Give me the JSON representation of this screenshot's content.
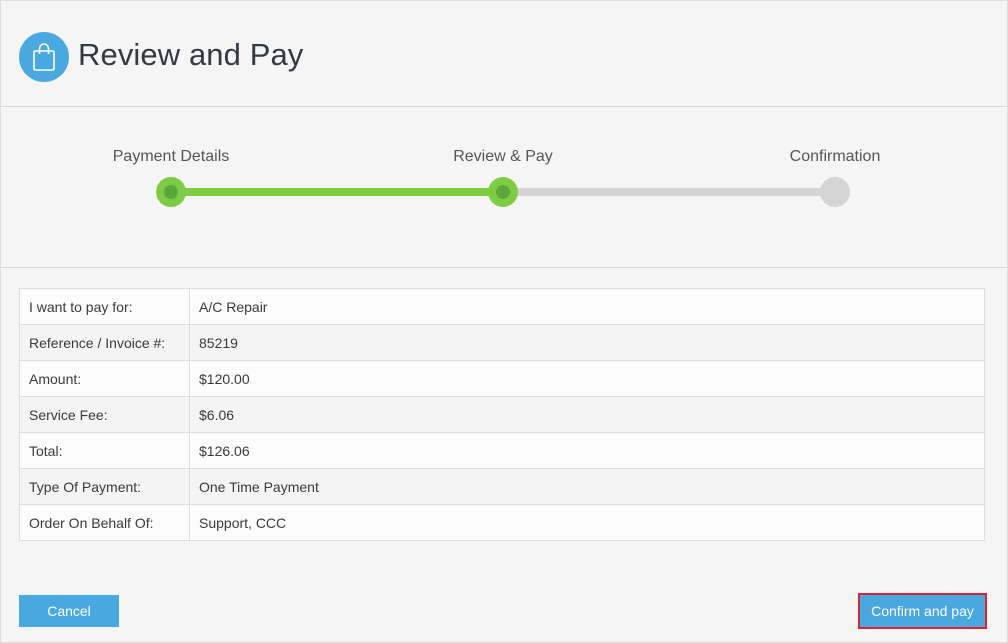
{
  "header": {
    "title": "Review and Pay",
    "icon": "shopping-bag-icon",
    "icon_color": "#4aa8e0"
  },
  "stepper": {
    "steps": [
      {
        "label": "Payment Details",
        "state": "complete"
      },
      {
        "label": "Review & Pay",
        "state": "current"
      },
      {
        "label": "Confirmation",
        "state": "pending"
      }
    ],
    "complete_color": "#7dcc44",
    "pending_color": "#d4d4d4"
  },
  "details": [
    {
      "label": "I want to pay for:",
      "value": "A/C Repair"
    },
    {
      "label": "Reference / Invoice #:",
      "value": "85219"
    },
    {
      "label": "Amount:",
      "value": "$120.00"
    },
    {
      "label": "Service Fee:",
      "value": "$6.06"
    },
    {
      "label": "Total:",
      "value": "$126.06"
    },
    {
      "label": "Type Of Payment:",
      "value": "One Time Payment"
    },
    {
      "label": "Order On Behalf Of:",
      "value": "Support, CCC"
    }
  ],
  "actions": {
    "cancel_label": "Cancel",
    "confirm_label": "Confirm and pay",
    "button_color": "#4aa8e0",
    "highlight_color": "#d9262e"
  }
}
